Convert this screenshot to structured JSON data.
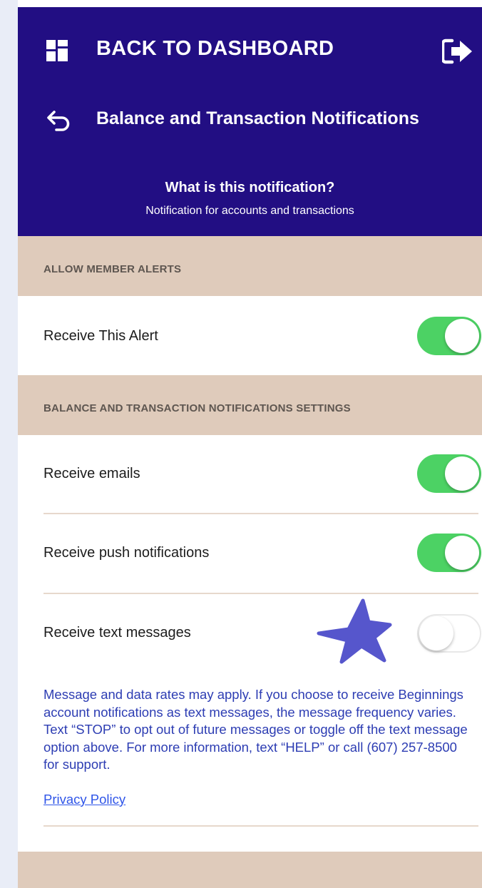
{
  "header": {
    "dashboard_label": "BACK TO DASHBOARD",
    "notification_title": "Balance and Transaction Notifications",
    "what_title": "What is this notification?",
    "what_subtitle": "Notification for accounts and transactions",
    "icons": {
      "dashboard": "dashboard-grid-icon",
      "logout": "logout-icon",
      "back": "back-arrow-icon"
    }
  },
  "sections": {
    "member_alerts": {
      "label": "ALLOW MEMBER ALERTS",
      "rows": [
        {
          "label": "Receive This Alert",
          "enabled": true
        }
      ]
    },
    "settings": {
      "label": "BALANCE AND TRANSACTION NOTIFICATIONS SETTINGS",
      "rows": [
        {
          "label": "Receive emails",
          "enabled": true
        },
        {
          "label": "Receive push notifications",
          "enabled": true
        },
        {
          "label": "Receive text messages",
          "enabled": false
        }
      ]
    }
  },
  "disclaimer": "Message and data rates may apply. If you choose to receive Beginnings account notifications as text messages, the message frequency varies. Text “STOP” to opt out of future messages or toggle off the text message option above. For more information, text “HELP” or call (607) 257-8500 for support.",
  "privacy_link": "Privacy Policy",
  "colors": {
    "header_bg": "#220e83",
    "section_bg": "#dfcbbb",
    "toggle_on": "#4cd264",
    "disclaimer_text": "#2d3db3",
    "link": "#2f55e8",
    "annotation_star": "#5656cc"
  }
}
